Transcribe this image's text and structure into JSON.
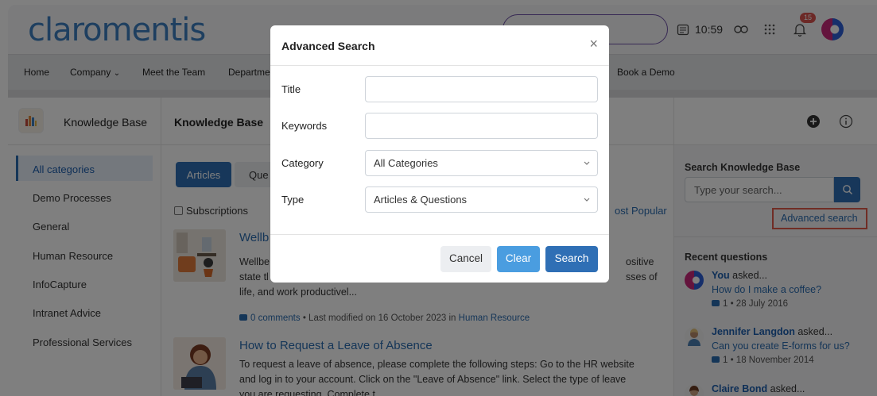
{
  "header": {
    "logo_text": "claromentis",
    "time": "10:59",
    "notification_count": "15"
  },
  "nav": {
    "items": [
      "Home",
      "Company",
      "Meet the Team",
      "Departme",
      "Book a Demo"
    ]
  },
  "left_panel": {
    "title": "Knowledge Base",
    "categories": [
      "All categories",
      "Demo Processes",
      "General",
      "Human Resource",
      "InfoCapture",
      "Intranet Advice",
      "Professional Services"
    ]
  },
  "center": {
    "title": "Knowledge Base",
    "tabs": [
      "Articles",
      "Que"
    ],
    "subscriptions_label": "Subscriptions",
    "most_popular_label": "ost Popular",
    "articles": [
      {
        "title": "Wellb",
        "body_line1": "Wellbe",
        "body_line1_right": "ositive",
        "body_line2": "state tl",
        "body_line2_right": "sses of",
        "body_line3": "life, and work productivel...",
        "comments": "0 comments",
        "meta_text": " • Last modified on 16 October 2023 in ",
        "category": "Human Resource"
      },
      {
        "title": "How to Request a Leave of Absence",
        "body_line1": "To request a leave of absence, please complete the following steps: Go to the HR website",
        "body_line2": "and log in to your account. Click on the \"Leave of Absence\" link. Select the type of leave",
        "body_line3": "you are requesting. Complete t..."
      }
    ]
  },
  "right_panel": {
    "search_title": "Search Knowledge Base",
    "search_placeholder": "Type your search...",
    "advanced_search_label": "Advanced search",
    "recent_title": "Recent questions",
    "questions": [
      {
        "author": "You",
        "verb": " asked...",
        "question": "How do I make a coffee?",
        "meta": "1 • 28 July 2016"
      },
      {
        "author": "Jennifer Langdon",
        "verb": " asked...",
        "question": "Can you create E-forms for us?",
        "meta": "1 • 18 November 2014"
      },
      {
        "author": "Claire Bond",
        "verb": " asked..."
      }
    ]
  },
  "modal": {
    "title": "Advanced Search",
    "fields": {
      "title_label": "Title",
      "keywords_label": "Keywords",
      "category_label": "Category",
      "category_value": "All Categories",
      "type_label": "Type",
      "type_value": "Articles & Questions"
    },
    "buttons": {
      "cancel": "Cancel",
      "clear": "Clear",
      "search": "Search"
    }
  },
  "colors": {
    "brand_blue": "#2f6fb5",
    "highlight_red": "#e15a4a",
    "active_bg": "#e8f0fb"
  }
}
